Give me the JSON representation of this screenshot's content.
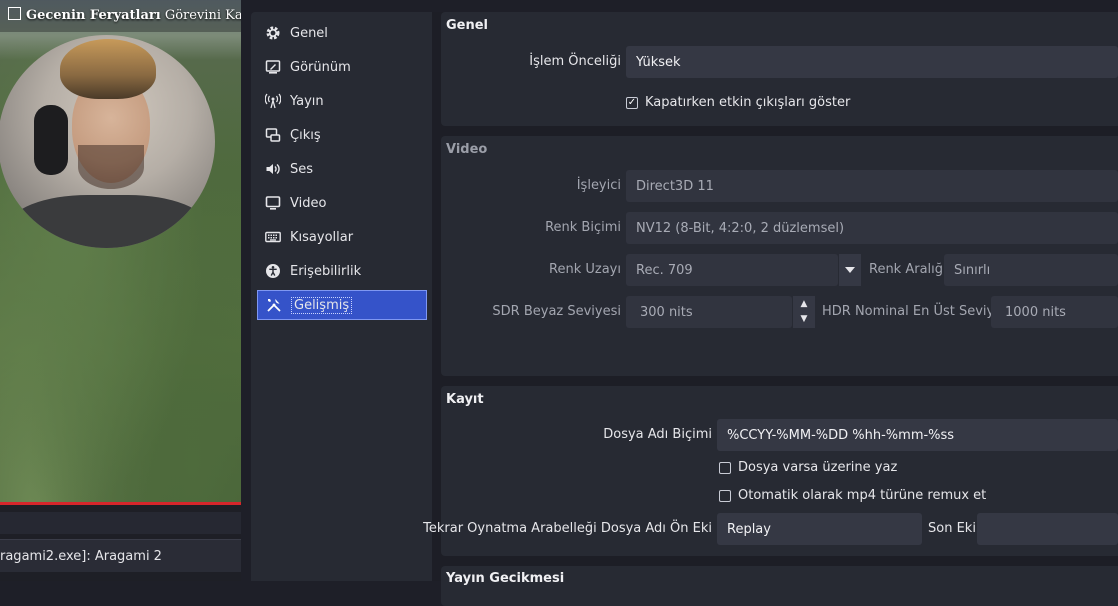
{
  "preview": {
    "title_bold": "Gecenin Feryatları",
    "title_rest": "Görevini Kabul",
    "status": "ragami2.exe]: Aragami 2"
  },
  "nav": [
    {
      "label": "Genel",
      "icon": "gear-icon"
    },
    {
      "label": "Görünüm",
      "icon": "appearance-icon"
    },
    {
      "label": "Yayın",
      "icon": "broadcast-icon"
    },
    {
      "label": "Çıkış",
      "icon": "output-icon"
    },
    {
      "label": "Ses",
      "icon": "speaker-icon"
    },
    {
      "label": "Video",
      "icon": "monitor-icon"
    },
    {
      "label": "Kısayollar",
      "icon": "keyboard-icon"
    },
    {
      "label": "Erişebilirlik",
      "icon": "accessibility-icon"
    },
    {
      "label": "Gelişmiş",
      "icon": "tools-icon",
      "active": true
    }
  ],
  "general": {
    "title": "Genel",
    "priority_label": "İşlem Önceliği",
    "priority_value": "Yüksek",
    "confirm_label": "Kapatırken etkin çıkışları göster",
    "confirm_checked": true
  },
  "video": {
    "title": "Video",
    "renderer_label": "İşleyici",
    "renderer_value": "Direct3D 11",
    "color_format_label": "Renk Biçimi",
    "color_format_value": "NV12 (8-Bit, 4:2:0, 2 düzlemsel)",
    "color_space_label": "Renk Uzayı",
    "color_space_value": "Rec. 709",
    "color_range_label": "Renk Aralığı",
    "color_range_value": "Sınırlı",
    "sdr_label": "SDR Beyaz Seviyesi",
    "sdr_value": "300 nits",
    "hdr_label": "HDR Nominal En Üst Seviye",
    "hdr_value": "1000 nits"
  },
  "recording": {
    "title": "Kayıt",
    "filename_label": "Dosya Adı Biçimi",
    "filename_value": "%CCYY-%MM-%DD %hh-%mm-%ss",
    "overwrite_label": "Dosya varsa üzerine yaz",
    "overwrite_checked": false,
    "remux_label": "Otomatik olarak mp4 türüne remux et",
    "remux_checked": false,
    "replay_prefix_label": "Tekrar Oynatma Arabelleği Dosya Adı Ön Eki",
    "replay_prefix_value": "Replay",
    "suffix_label": "Son Eki",
    "suffix_value": ""
  },
  "delay": {
    "title": "Yayın Gecikmesi"
  },
  "colors": {
    "accent": "#3553c9",
    "panel": "#272a33",
    "field": "#353844",
    "record_red": "#d6262b"
  }
}
